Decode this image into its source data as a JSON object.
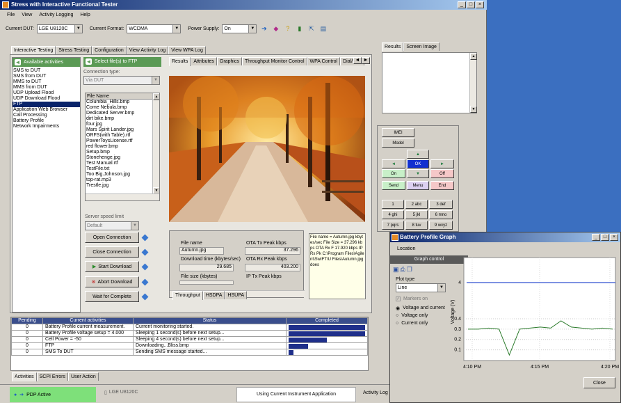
{
  "app": {
    "title": "Stress with Interactive Functional Tester"
  },
  "menu": [
    "File",
    "View",
    "Activity Logging",
    "Help"
  ],
  "toolbar": {
    "current_dut_label": "Current DUT:",
    "current_dut": "LGE U8120C",
    "current_format_label": "Current Format:",
    "current_format": "WCDMA",
    "power_supply_label": "Power Supply:",
    "power_supply": "On"
  },
  "main_tabs": [
    "Interactive Testing",
    "Stress Testing",
    "Configuration",
    "View Activity Log",
    "View WPA Log"
  ],
  "activities": {
    "header": "Available activities",
    "items": [
      "SMS to DUT",
      "SMS from DUT",
      "MMS to DUT",
      "MMS from DUT",
      "UDP Upload Flood",
      "UDP Download Flood",
      "FTP",
      "Application Web Browser",
      "Call Processing",
      "Battery Profile",
      "Network Impairments"
    ],
    "selected": "FTP"
  },
  "ftp": {
    "header": "Select file(s) to FTP",
    "connection_type_label": "Connection type:",
    "connection_type": "Via DUT",
    "file_list_header": "File Name",
    "files": [
      "Columbia_Hills.bmp",
      "Come Nebula.bmp",
      "Dedicated Server.bmp",
      "dirt bike.bmp",
      "four.jpg",
      "Mars Spirit Lander.jpg",
      "ORFS(with Table).rtf",
      "PowerToysLicense.rtf",
      "red flower.bmp",
      "Setup.bmp",
      "Stonehenge.jpg",
      "Test Manual.rtf",
      "TestFile.txt",
      "Too Big.Johnson.jpg",
      "top-rat.mp3",
      "Trestle.jpg"
    ],
    "server_speed_label": "Server speed limit",
    "server_speed": "Default",
    "buttons": [
      "Open Connection",
      "Close Connection",
      "Start Download",
      "Abort Download",
      "Wait for Complete"
    ]
  },
  "result_tabs": [
    "Results",
    "Attributes",
    "Graphics",
    "Throughput Monitor Control",
    "WPA Control",
    "Dial/Han"
  ],
  "stats": {
    "file_name_label": "File name",
    "file_name": "Autumn.jpg",
    "download_time_label": "Download time (kbytes/sec)",
    "download_time": "29.685",
    "file_size_label": "File size (kbytes)",
    "ota_tx_label": "OTA Tx Peak kbps",
    "ota_tx": "37.296",
    "ota_rx_label": "OTA Rx Peak kbps",
    "ota_rx": "403.200",
    "ip_tx_label": "IP Tx Peak kbps",
    "log_text": "File name = Autumn.jpg kbytes/sec File Size = 37.296 kbps OTA Rx F 17.920 kbps IP Rx Pk C:\\Program Files\\Agilent\\SwIFT\\U Files\\Autumn.jpg does"
  },
  "bottom_tabs": [
    "Throughput",
    "HSDPA",
    "HSUPA"
  ],
  "right_panel": {
    "tabs": [
      "Results",
      "Screen Image"
    ]
  },
  "keypad": {
    "imei": "IMEI",
    "model": "Model",
    "ok": "OK",
    "on": "On",
    "off": "Off",
    "send": "Send",
    "menu": "Menu",
    "end": "End",
    "keys": [
      "1",
      "2 abc",
      "3 def",
      "4 ghi",
      "5 jkl",
      "6 mno",
      "7 pqrs",
      "8 tuv",
      "9 wxyz"
    ]
  },
  "activity_table": {
    "headers": [
      "Pending",
      "Current activities",
      "Status",
      "Completed"
    ],
    "rows": [
      {
        "pending": "0",
        "activity": "Battery Profile current measurement.",
        "status": "Current monitoring started.",
        "progress": 1.0
      },
      {
        "pending": "0",
        "activity": "Battery Profile voltage setup = 4.000",
        "status": "Sleeping 1 second(s) before next setup...",
        "progress": 1.0
      },
      {
        "pending": "0",
        "activity": "Cell Power = -50",
        "status": "Sleeping 4 second(s) before next setup...",
        "progress": 0.5
      },
      {
        "pending": "0",
        "activity": "FTP",
        "status": "Downloading...Bliss.bmp",
        "progress": 0.25
      },
      {
        "pending": "0",
        "activity": "SMS To DUT",
        "status": "Sending SMS message started...",
        "progress": 0.06
      }
    ]
  },
  "lower_tabs": [
    "Activities",
    "SCPI Errors",
    "User Action"
  ],
  "statusbar": {
    "pdp": "PDP Active",
    "dut": "LGE U8120C",
    "app": "Using Current Instrument Application",
    "log": "Activity Log"
  },
  "battery": {
    "title": "Battery Profile Graph",
    "location_label": "Location",
    "graph_control": "Graph control",
    "plot_type_label": "Plot type",
    "plot_type": "Line",
    "markers_on": "Markers on",
    "options": [
      "Voltage and current",
      "Voltage only",
      "Current only"
    ],
    "selected_option": "Voltage and current",
    "close": "Close"
  },
  "chart_data": {
    "type": "line",
    "ylabel": "Voltage (V)",
    "y_ticks": [
      "4",
      "0.4",
      "0.3",
      "0.2",
      "0.1"
    ],
    "x_ticks": [
      "4:10 PM",
      "4:15 PM",
      "4:20 PM"
    ],
    "series": [
      {
        "values": [
          4.0,
          4.0
        ]
      },
      {
        "values": [
          0.3,
          0.3,
          0.31,
          0.3,
          0.05,
          0.3,
          0.31,
          0.32,
          0.31,
          0.38,
          0.32,
          0.31,
          0.3,
          0.31,
          0.3
        ]
      }
    ]
  },
  "colors": {
    "accent": "#0a246a",
    "green": "#5b9a55",
    "progress": "#1f2f8a"
  }
}
